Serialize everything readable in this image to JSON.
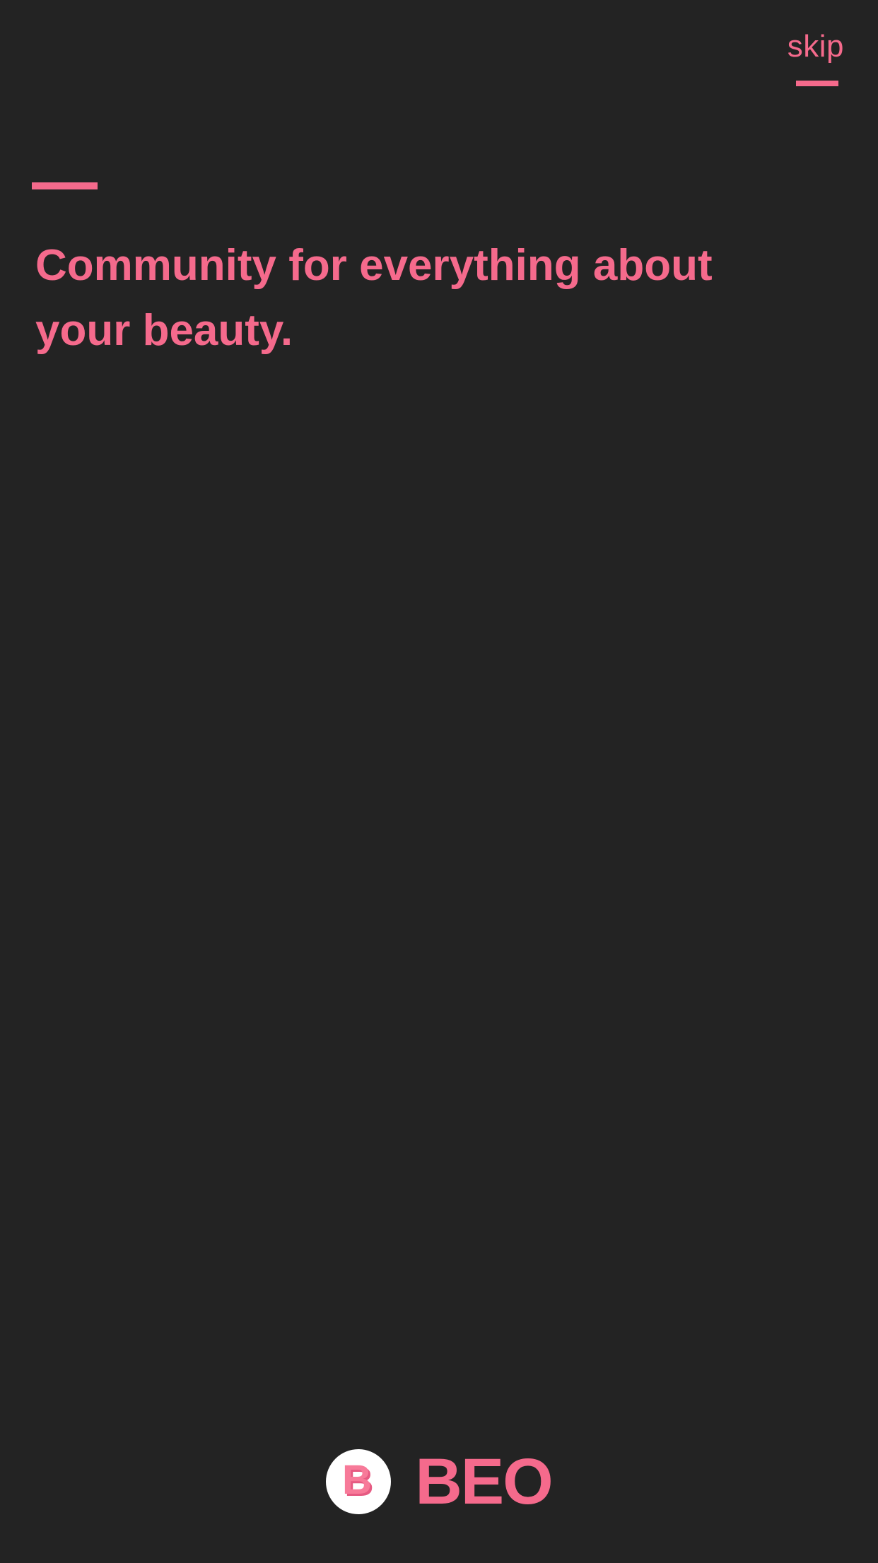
{
  "header": {
    "skip_label": "skip"
  },
  "onboarding": {
    "headline": "Community for everything about your beauty."
  },
  "brand": {
    "badge_letter": "B",
    "name": "BEO",
    "logo_icon": "beo-logo-icon"
  },
  "colors": {
    "background": "#232323",
    "accent": "#f56a8c",
    "badge_background": "#ffffff"
  }
}
